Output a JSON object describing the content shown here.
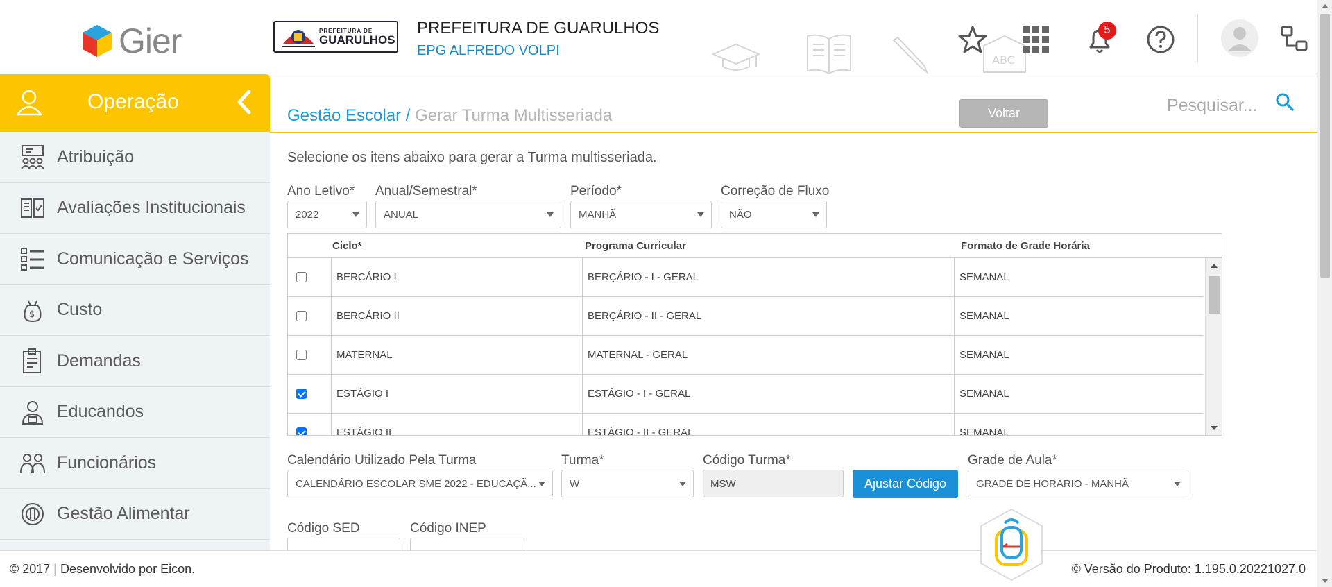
{
  "header": {
    "logo_text": "Gier",
    "crest_small": "PREFEITURA DE",
    "crest_big": "GUARULHOS",
    "prefeitura": "PREFEITURA DE GUARULHOS",
    "school": "EPG ALFREDO VOLPI",
    "notifications_count": "5",
    "icons": [
      "star-icon",
      "apps-grid-icon",
      "bell-icon",
      "help-icon",
      "user-avatar-icon",
      "switch-icon"
    ]
  },
  "sidebar": {
    "title": "Operação",
    "items": [
      {
        "label": "Atribuição",
        "icon": "classroom-icon"
      },
      {
        "label": "Avaliações Institucionais",
        "icon": "book-check-icon"
      },
      {
        "label": "Comunicação e Serviços",
        "icon": "checklist-icon"
      },
      {
        "label": "Custo",
        "icon": "money-bag-icon"
      },
      {
        "label": "Demandas",
        "icon": "clipboard-icon"
      },
      {
        "label": "Educandos",
        "icon": "student-icon"
      },
      {
        "label": "Funcionários",
        "icon": "staff-icon"
      },
      {
        "label": "Gestão Alimentar",
        "icon": "plate-icon"
      }
    ]
  },
  "breadcrumb": {
    "root": "Gestão Escolar /",
    "current": "Gerar Turma Multisseriada"
  },
  "voltar_label": "Voltar",
  "search_placeholder": "Pesquisar...",
  "intro": "Selecione os itens abaixo para gerar a Turma multisseriada.",
  "filters": {
    "ano_letivo": {
      "label": "Ano Letivo*",
      "value": "2022"
    },
    "anual_semestral": {
      "label": "Anual/Semestral*",
      "value": "ANUAL"
    },
    "periodo": {
      "label": "Período*",
      "value": "MANHÃ"
    },
    "correcao_fluxo": {
      "label": "Correção de Fluxo",
      "value": "NÃO"
    }
  },
  "table": {
    "headers": [
      "Ciclo*",
      "Programa Curricular",
      "Formato de Grade Horária"
    ],
    "rows": [
      {
        "checked": false,
        "ciclo": "BERCÁRIO I",
        "programa": "BERÇÁRIO - I - GERAL",
        "formato": "SEMANAL"
      },
      {
        "checked": false,
        "ciclo": "BERCÁRIO II",
        "programa": "BERÇÁRIO - II - GERAL",
        "formato": "SEMANAL"
      },
      {
        "checked": false,
        "ciclo": "MATERNAL",
        "programa": "MATERNAL - GERAL",
        "formato": "SEMANAL"
      },
      {
        "checked": true,
        "ciclo": "ESTÁGIO I",
        "programa": "ESTÁGIO - I - GERAL",
        "formato": "SEMANAL"
      },
      {
        "checked": true,
        "ciclo": "ESTÁGIO II",
        "programa": "ESTÁGIO - II - GERAL",
        "formato": "SEMANAL"
      }
    ]
  },
  "form": {
    "calendario": {
      "label": "Calendário Utilizado Pela Turma",
      "value": "CALENDÁRIO ESCOLAR SME 2022 - EDUCAÇÃ..."
    },
    "turma": {
      "label": "Turma*",
      "value": "W"
    },
    "codigo_turma": {
      "label": "Código Turma*",
      "value": "MSW"
    },
    "ajustar_label": "Ajustar Código",
    "grade_aula": {
      "label": "Grade de Aula*",
      "value": "GRADE DE HORARIO - MANHÃ"
    },
    "codigo_sed": {
      "label": "Código SED",
      "value": ""
    },
    "codigo_inep": {
      "label": "Código INEP",
      "value": ""
    }
  },
  "footer": {
    "left": "© 2017 | Desenvolvido por Eicon.",
    "right": "© Versão do Produto: 1.195.0.20221027.0"
  },
  "colors": {
    "accent_yellow": "#fdc400",
    "link_blue": "#1a9bd7",
    "button_blue": "#1a90d8",
    "badge_red": "#e21b1b"
  }
}
